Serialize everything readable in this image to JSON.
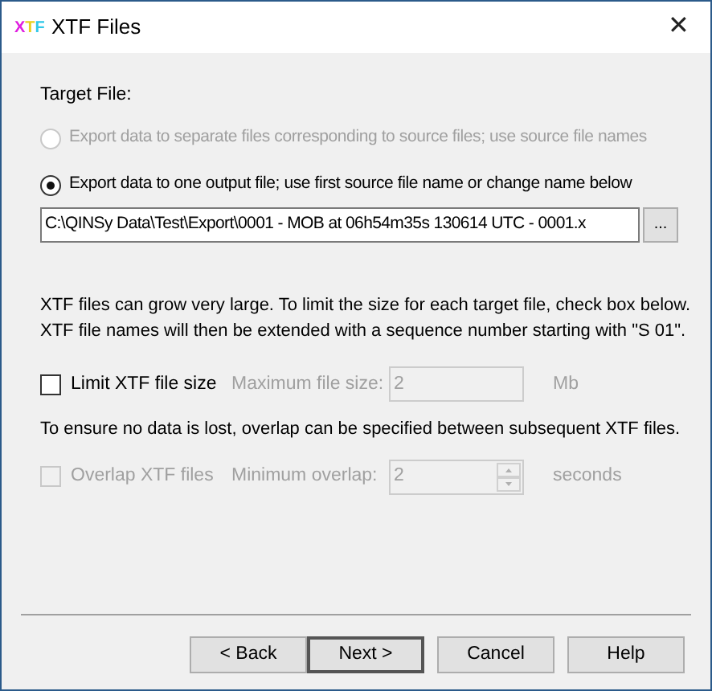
{
  "window": {
    "logo": "XTF",
    "title": "XTF Files",
    "close": "✕"
  },
  "target_label": "Target File:",
  "options": [
    {
      "label": "Export data to separate files corresponding to source files; use source file names",
      "selected": false,
      "disabled": true
    },
    {
      "label": "Export data to one output file; use first source file name or change name below",
      "selected": true,
      "disabled": false
    }
  ],
  "file_path": "C:\\QINSy Data\\Test\\Export\\0001 - MOB at 06h54m35s 130614 UTC - 0001.x",
  "browse": "...",
  "info": [
    "XTF files can grow very large. To limit the size for each target file, check box below.",
    "XTF file names will then be extended with a sequence number starting with \"S 01\"."
  ],
  "limit": {
    "label": "Limit XTF file size",
    "checked": false,
    "disabled": false,
    "field_label": "Maximum file size:",
    "value": "2",
    "unit": "Mb",
    "field_disabled": true,
    "spinner": false
  },
  "overlap_info": "To ensure no data is lost, overlap can be specified between subsequent XTF files.",
  "overlap": {
    "label": "Overlap XTF files",
    "checked": false,
    "disabled": true,
    "field_label": "Minimum overlap:",
    "value": "2",
    "unit": "seconds",
    "field_disabled": true,
    "spinner": true
  },
  "buttons": [
    {
      "label": "< Back",
      "default": false
    },
    {
      "label": "Next >",
      "default": true
    },
    {
      "label": "Cancel",
      "default": false
    },
    {
      "label": "Help",
      "default": false
    }
  ]
}
